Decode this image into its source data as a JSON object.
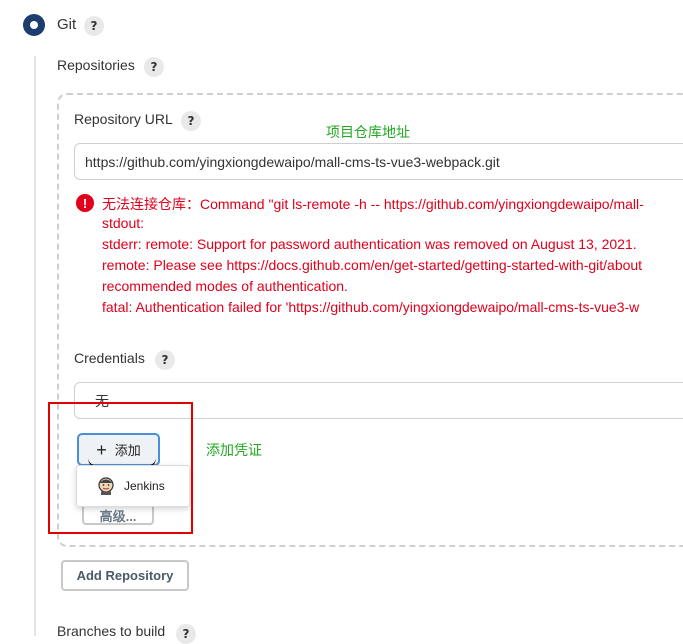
{
  "scm": {
    "option_label": "Git"
  },
  "repositories": {
    "label": "Repositories"
  },
  "repository_url": {
    "label": "Repository URL",
    "value": "https://github.com/yingxiongdewaipo/mall-cms-ts-vue3-webpack.git",
    "annotation": "项目仓库地址"
  },
  "error": {
    "lines": [
      "无法连接仓库：Command \"git ls-remote -h -- https://github.com/yingxiongdewaipo/mall-",
      "stdout:",
      "stderr: remote: Support for password authentication was removed on August 13, 2021.",
      "remote: Please see https://docs.github.com/en/get-started/getting-started-with-git/about",
      "recommended modes of authentication.",
      "fatal: Authentication failed for 'https://github.com/yingxiongdewaipo/mall-cms-ts-vue3-w"
    ]
  },
  "credentials": {
    "label": "Credentials",
    "selected": "无",
    "add_button": "添加",
    "annotation": "添加凭证",
    "menu_item": "Jenkins",
    "advanced_button": "高级..."
  },
  "add_repository_button": "Add Repository",
  "branches_label": "Branches to build",
  "help_symbol": "?",
  "colors": {
    "error": "#e0001b",
    "annotation": "#22a822",
    "highlight_box": "#e00000",
    "radio": "#1c3e6e"
  }
}
